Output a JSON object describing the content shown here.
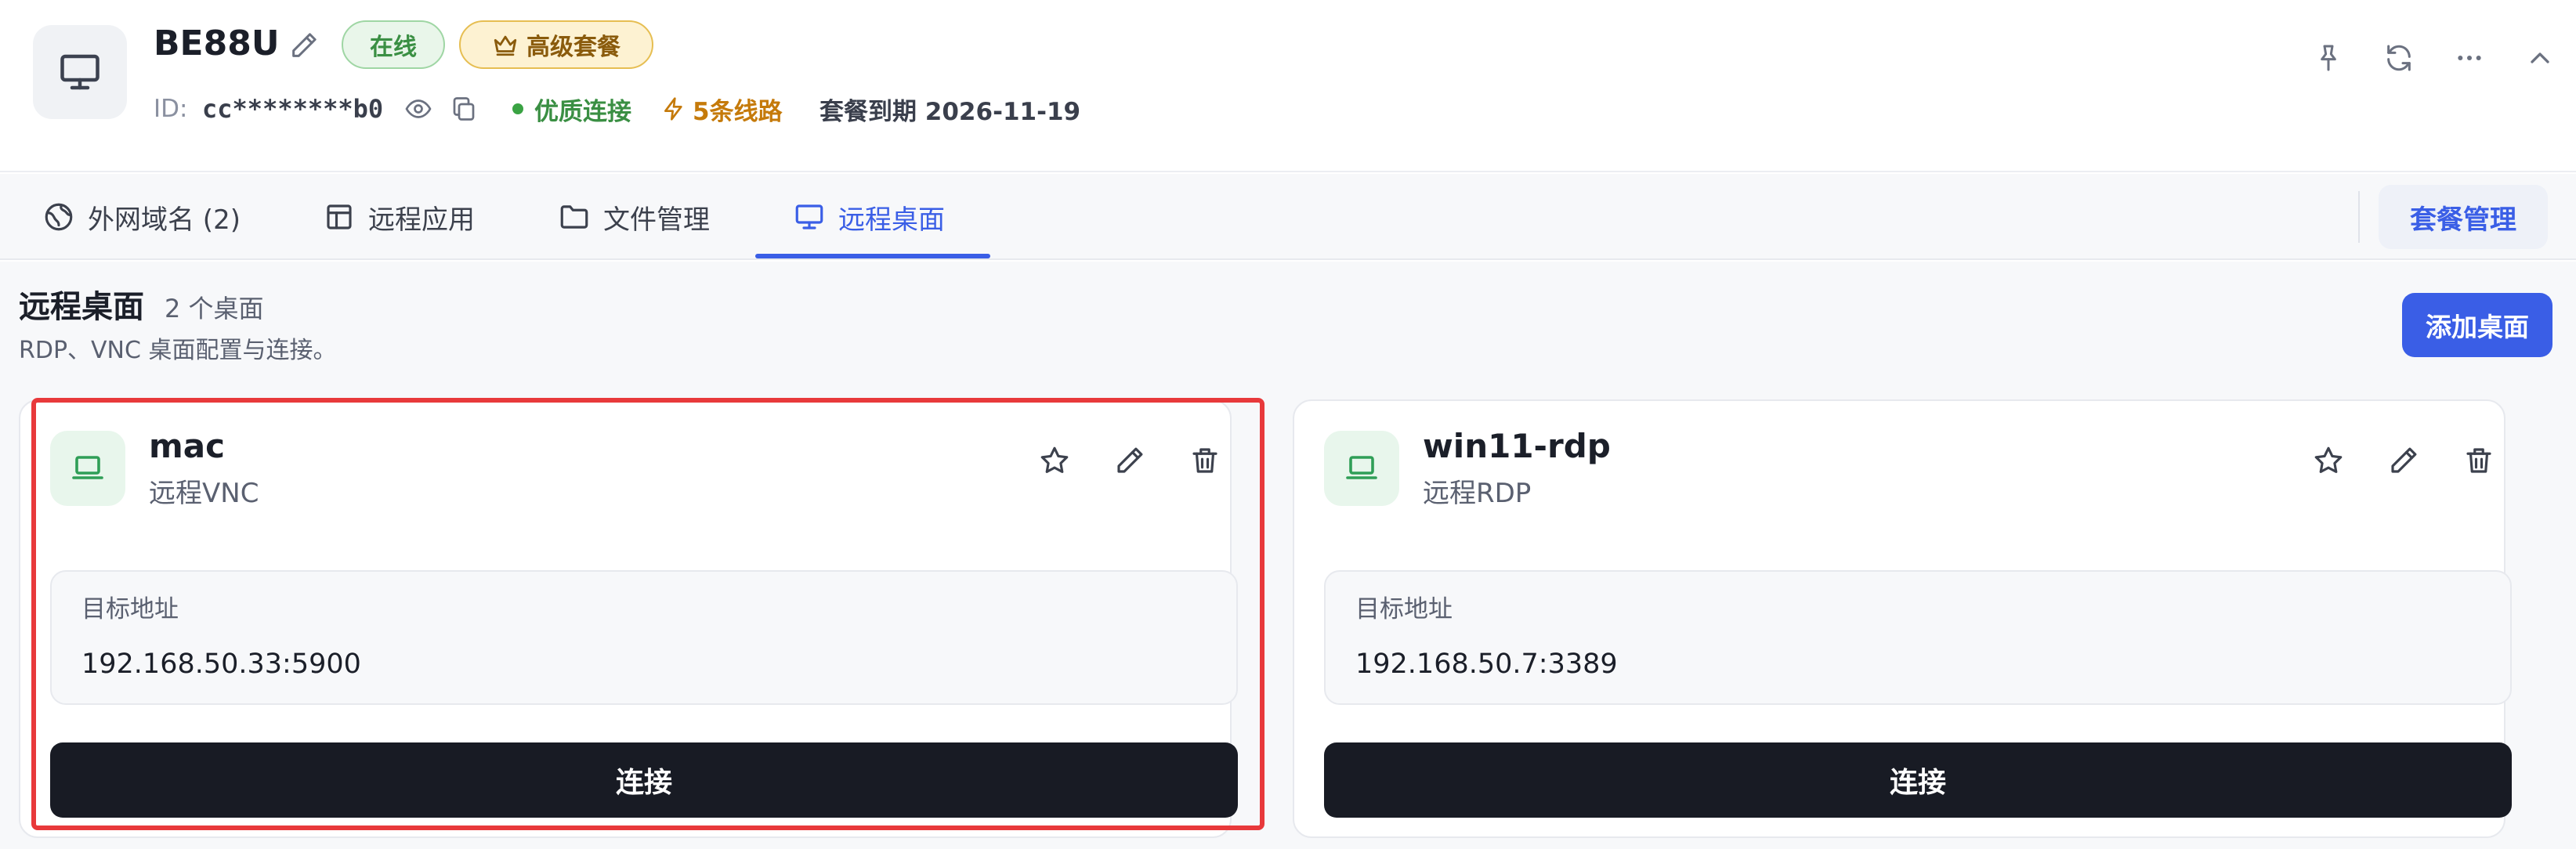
{
  "device": {
    "name": "BE88U",
    "status_badge": "在线",
    "plan_badge": "高级套餐",
    "id_label": "ID:",
    "id_value": "cc********b0",
    "connection_quality": "优质连接",
    "routes": "5条线路",
    "expiry": "套餐到期 2026-11-19"
  },
  "tabs": [
    {
      "label": "外网域名 (2)",
      "icon": "globe-icon",
      "active": false
    },
    {
      "label": "远程应用",
      "icon": "layout-icon",
      "active": false
    },
    {
      "label": "文件管理",
      "icon": "folder-icon",
      "active": false
    },
    {
      "label": "远程桌面",
      "icon": "monitor-icon",
      "active": true
    }
  ],
  "plan_button": "套餐管理",
  "section": {
    "title": "远程桌面",
    "count": "2 个桌面",
    "description": "RDP、VNC 桌面配置与连接。",
    "add_button": "添加桌面"
  },
  "desktops": [
    {
      "name": "mac",
      "type": "远程VNC",
      "address_label": "目标地址",
      "address": "192.168.50.33:5900",
      "connect_label": "连接"
    },
    {
      "name": "win11-rdp",
      "type": "远程RDP",
      "address_label": "目标地址",
      "address": "192.168.50.7:3389",
      "connect_label": "连接"
    }
  ],
  "colors": {
    "accent": "#3a5ee6",
    "online_green": "#3a8f43",
    "routes_orange": "#c57a0a",
    "highlight_red": "#e8393b",
    "button_dark": "#181b24"
  }
}
